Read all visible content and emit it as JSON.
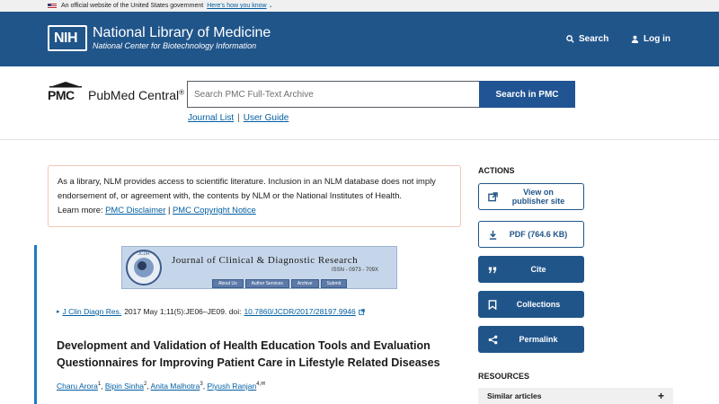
{
  "gov_banner": {
    "text": "An official website of the United States government",
    "link": "Here's how you know"
  },
  "header": {
    "logo_mark": "NIH",
    "title": "National Library of Medicine",
    "subtitle": "National Center for Biotechnology Information",
    "search_label": "Search",
    "login_label": "Log in",
    "bg_color": "#20558a"
  },
  "pmc": {
    "logo_mark": "PMC",
    "name": "PubMed Central",
    "reg": "®",
    "search_placeholder": "Search PMC Full-Text Archive",
    "search_button": "Search in PMC",
    "links": [
      "Journal List",
      "User Guide"
    ],
    "link_separator": "|"
  },
  "notice": {
    "text1": "As a library, NLM provides access to scientific literature. Inclusion in an NLM database does not imply endorsement of, or agreement with, the contents by NLM or the National Institutes of Health.",
    "learn_more": "Learn more:",
    "link1": "PMC Disclaimer",
    "separator": "|",
    "link2": "PMC Copyright Notice"
  },
  "journal_banner": {
    "title": "Journal of Clinical & Diagnostic Research",
    "issn": "ISSN - 0973 - 709X",
    "nav": [
      "About Us",
      "Author Services",
      "Archive",
      "Submit"
    ]
  },
  "article": {
    "citation_journal": "J Clin Diagn Res.",
    "citation_text": "2017 May 1;11(5):JE06–JE09. doi:",
    "doi": "10.7860/JCDR/2017/28197.9946",
    "title": "Development and Validation of Health Education Tools and Evaluation Questionnaires for Improving Patient Care in Lifestyle Related Diseases",
    "authors": [
      {
        "name": "Charu Arora",
        "sup": "1"
      },
      {
        "name": "Bipin Sinha",
        "sup": "2"
      },
      {
        "name": "Anita Malhotra",
        "sup": "3"
      },
      {
        "name": "Piyush Ranjan",
        "sup": "4,✉"
      }
    ]
  },
  "actions": {
    "heading": "ACTIONS",
    "view_publisher": "View on publisher site",
    "pdf": "PDF (764.6 KB)",
    "cite": "Cite",
    "collections": "Collections",
    "permalink": "Permalink"
  },
  "resources": {
    "heading": "RESOURCES",
    "similar": "Similar articles",
    "similar_toggle": "+"
  }
}
